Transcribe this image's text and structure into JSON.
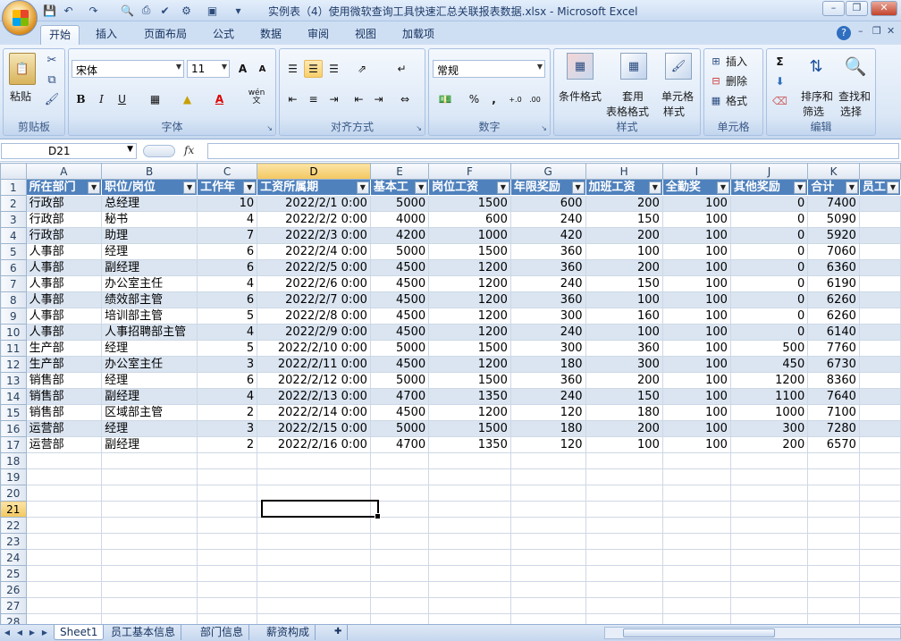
{
  "window": {
    "title": "实例表（4）使用微软查询工具快速汇总关联报表数据.xlsx - Microsoft Excel"
  },
  "tabs": [
    "开始",
    "插入",
    "页面布局",
    "公式",
    "数据",
    "审阅",
    "视图",
    "加载项"
  ],
  "active_tab": "开始",
  "ribbon": {
    "clipboard": {
      "paste": "粘贴",
      "label": "剪贴板"
    },
    "font": {
      "name": "宋体",
      "size": "11",
      "bold": "B",
      "italic": "I",
      "underline": "U",
      "grow": "A",
      "shrink": "A",
      "font_color_glyph": "A",
      "wen": "wén\n文",
      "label": "字体"
    },
    "alignment": {
      "label": "对齐方式"
    },
    "number": {
      "format": "常规",
      "percent": "%",
      "comma": ",",
      "label": "数字"
    },
    "styles": {
      "cond_format": "条件格式",
      "table_format_1": "套用",
      "table_format_2": "表格格式",
      "cell_style_1": "单元格",
      "cell_style_2": "样式",
      "label": "样式"
    },
    "cells": {
      "insert": "插入",
      "delete": "删除",
      "format": "格式",
      "label": "单元格"
    },
    "editing": {
      "sigma": "Σ",
      "sort_1": "排序和",
      "sort_2": "筛选",
      "find_1": "查找和",
      "find_2": "选择",
      "label": "编辑"
    }
  },
  "formula_bar": {
    "name_box": "D21",
    "fx": "fx",
    "content": ""
  },
  "columns": [
    "A",
    "B",
    "C",
    "D",
    "E",
    "F",
    "G",
    "H",
    "I",
    "J",
    "K",
    ""
  ],
  "selected_column": "D",
  "selected_row": "21",
  "headers": [
    "所在部门",
    "职位/岗位",
    "工作年",
    "工资所属期",
    "基本工",
    "岗位工资",
    "年限奖励",
    "加班工资",
    "全勤奖",
    "其他奖励",
    "合计",
    "员工"
  ],
  "rows": [
    [
      "2",
      "行政部",
      "总经理",
      "10",
      "2022/2/1  0:00",
      "5000",
      "1500",
      "600",
      "200",
      "100",
      "0",
      "7400"
    ],
    [
      "3",
      "行政部",
      "秘书",
      "4",
      "2022/2/2  0:00",
      "4000",
      "600",
      "240",
      "150",
      "100",
      "0",
      "5090"
    ],
    [
      "4",
      "行政部",
      "助理",
      "7",
      "2022/2/3  0:00",
      "4200",
      "1000",
      "420",
      "200",
      "100",
      "0",
      "5920"
    ],
    [
      "5",
      "人事部",
      "经理",
      "6",
      "2022/2/4  0:00",
      "5000",
      "1500",
      "360",
      "100",
      "100",
      "0",
      "7060"
    ],
    [
      "6",
      "人事部",
      "副经理",
      "6",
      "2022/2/5  0:00",
      "4500",
      "1200",
      "360",
      "200",
      "100",
      "0",
      "6360"
    ],
    [
      "7",
      "人事部",
      "办公室主任",
      "4",
      "2022/2/6  0:00",
      "4500",
      "1200",
      "240",
      "150",
      "100",
      "0",
      "6190"
    ],
    [
      "8",
      "人事部",
      "绩效部主管",
      "6",
      "2022/2/7  0:00",
      "4500",
      "1200",
      "360",
      "100",
      "100",
      "0",
      "6260"
    ],
    [
      "9",
      "人事部",
      "培训部主管",
      "5",
      "2022/2/8  0:00",
      "4500",
      "1200",
      "300",
      "160",
      "100",
      "0",
      "6260"
    ],
    [
      "10",
      "人事部",
      "人事招聘部主管",
      "4",
      "2022/2/9  0:00",
      "4500",
      "1200",
      "240",
      "100",
      "100",
      "0",
      "6140"
    ],
    [
      "11",
      "生产部",
      "经理",
      "5",
      "2022/2/10  0:00",
      "5000",
      "1500",
      "300",
      "360",
      "100",
      "500",
      "7760"
    ],
    [
      "12",
      "生产部",
      "办公室主任",
      "3",
      "2022/2/11  0:00",
      "4500",
      "1200",
      "180",
      "300",
      "100",
      "450",
      "6730"
    ],
    [
      "13",
      "销售部",
      "经理",
      "6",
      "2022/2/12  0:00",
      "5000",
      "1500",
      "360",
      "200",
      "100",
      "1200",
      "8360"
    ],
    [
      "14",
      "销售部",
      "副经理",
      "4",
      "2022/2/13  0:00",
      "4700",
      "1350",
      "240",
      "150",
      "100",
      "1100",
      "7640"
    ],
    [
      "15",
      "销售部",
      "区域部主管",
      "2",
      "2022/2/14  0:00",
      "4500",
      "1200",
      "120",
      "180",
      "100",
      "1000",
      "7100"
    ],
    [
      "16",
      "运营部",
      "经理",
      "3",
      "2022/2/15  0:00",
      "5000",
      "1500",
      "180",
      "200",
      "100",
      "300",
      "7280"
    ],
    [
      "17",
      "运营部",
      "副经理",
      "2",
      "2022/2/16  0:00",
      "4700",
      "1350",
      "120",
      "100",
      "100",
      "200",
      "6570"
    ]
  ],
  "empty_rows": [
    "18",
    "19",
    "20",
    "21",
    "22",
    "23",
    "24",
    "25",
    "26",
    "27",
    "28"
  ],
  "sheet_tabs": [
    "Sheet1",
    "员工基本信息",
    "部门信息",
    "薪资构成"
  ],
  "active_sheet": "Sheet1"
}
